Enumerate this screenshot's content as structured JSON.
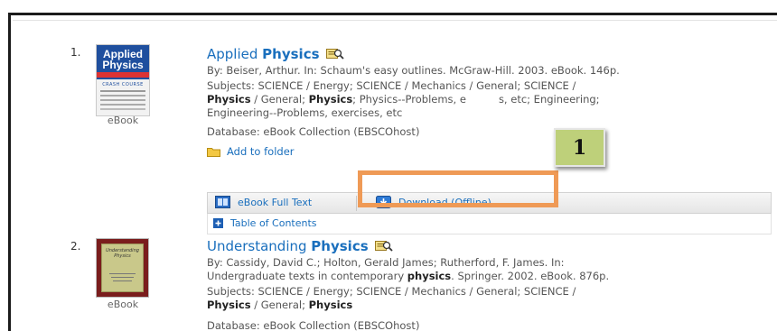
{
  "results": [
    {
      "number": "1.",
      "cover": {
        "line1": "Applied",
        "line2": "Physics",
        "strip": "CRASH COURSE"
      },
      "format_label": "eBook",
      "title_prefix": "Applied ",
      "title_bold": "Physics",
      "byline": "By: Beiser, Arthur. In: Schaum's easy outlines. McGraw-Hill. 2003. eBook. 146p.",
      "subjects_line1": "Subjects: SCIENCE / Energy; SCIENCE / Mechanics / General; SCIENCE /",
      "subjects_line2": {
        "b1": "Physics",
        "t1": " / General; ",
        "b2": "Physics",
        "t2": "; Physics--Problems, e",
        "t3": "s, etc; Engineering;"
      },
      "subjects_line3": "Engineering--Problems, exercises, etc",
      "database": "Database: eBook Collection (EBSCOhost)",
      "add_to_folder": "Add to folder",
      "full_text": "eBook Full Text",
      "download": "Download (Offline)",
      "toc": "Table of Contents"
    },
    {
      "number": "2.",
      "cover": {
        "line1": "Understanding Physics"
      },
      "format_label": "eBook",
      "title_prefix": "Understanding ",
      "title_bold": "Physics",
      "byline": "By: Cassidy, David C.; Holton, Gerald James; Rutherford, F. James. In:",
      "byline2": {
        "t1": "Undergraduate texts in contemporary ",
        "b1": "physics",
        "t2": ". Springer. 2002. eBook. 876p."
      },
      "subjects_line1": "Subjects: SCIENCE / Energy; SCIENCE / Mechanics / General; SCIENCE /",
      "subjects_line2": {
        "b1": "Physics",
        "t1": " / General; ",
        "b2": "Physics"
      },
      "database": "Database: eBook Collection (EBSCOhost)"
    }
  ],
  "annotation": {
    "label": "1",
    "highlight_color": "#ef9a56",
    "badge_color": "#bed07a"
  },
  "colors": {
    "link": "#1a6fbd"
  }
}
